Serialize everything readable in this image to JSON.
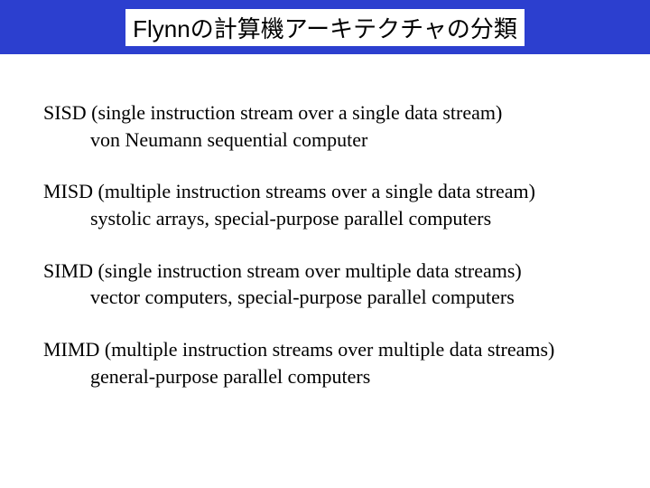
{
  "header": {
    "title": "Flynnの計算機アーキテクチャの分類"
  },
  "items": [
    {
      "line1": "SISD (single instruction stream over a single data stream)",
      "line2": "von Neumann sequential computer"
    },
    {
      "line1": "MISD (multiple instruction streams over a single data stream)",
      "line2": "systolic arrays, special-purpose parallel computers"
    },
    {
      "line1": "SIMD (single instruction stream over multiple data streams)",
      "line2": "vector computers, special-purpose parallel computers"
    },
    {
      "line1": "MIMD (multiple instruction streams over multiple data streams)",
      "line2": "general-purpose parallel computers"
    }
  ]
}
